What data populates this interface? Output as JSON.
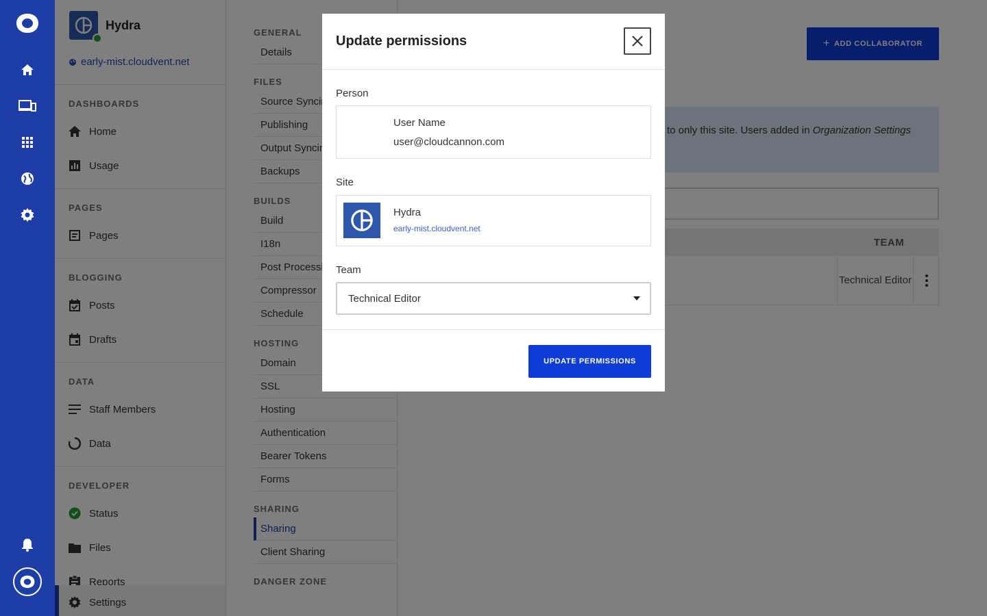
{
  "sidebar": {
    "site_name": "Hydra",
    "site_url": "early-mist.cloudvent.net",
    "sections": [
      {
        "title": "DASHBOARDS",
        "items": [
          {
            "label": "Home",
            "icon": "home-icon"
          },
          {
            "label": "Usage",
            "icon": "chart-icon"
          }
        ]
      },
      {
        "title": "PAGES",
        "items": [
          {
            "label": "Pages",
            "icon": "page-icon"
          }
        ]
      },
      {
        "title": "BLOGGING",
        "items": [
          {
            "label": "Posts",
            "icon": "calendar-check-icon"
          },
          {
            "label": "Drafts",
            "icon": "calendar-icon"
          }
        ]
      },
      {
        "title": "DATA",
        "items": [
          {
            "label": "Staff Members",
            "icon": "list-icon"
          },
          {
            "label": "Data",
            "icon": "data-ring-icon"
          }
        ]
      },
      {
        "title": "DEVELOPER",
        "items": [
          {
            "label": "Status",
            "icon": "check-circle-icon"
          },
          {
            "label": "Files",
            "icon": "folder-icon"
          },
          {
            "label": "Reports",
            "icon": "clipboard-icon"
          }
        ]
      }
    ],
    "settings_label": "Settings"
  },
  "settings_nav": {
    "groups": [
      {
        "title": "GENERAL",
        "items": [
          "Details"
        ]
      },
      {
        "title": "FILES",
        "items": [
          "Source Syncing",
          "Publishing",
          "Output Syncing",
          "Backups"
        ]
      },
      {
        "title": "BUILDS",
        "items": [
          "Build",
          "I18n",
          "Post Processing",
          "Compressor",
          "Schedule"
        ]
      },
      {
        "title": "HOSTING",
        "items": [
          "Domain",
          "SSL",
          "Hosting",
          "Authentication",
          "Bearer Tokens",
          "Forms"
        ]
      },
      {
        "title": "SHARING",
        "items": [
          "Sharing",
          "Client Sharing"
        ]
      }
    ],
    "active": "Sharing",
    "partial_group": "DANGER ZONE"
  },
  "main": {
    "add_button": "ADD COLLABORATOR",
    "info_text": "to only this site. Users added in ",
    "info_italic": "Organization Settings",
    "table_team_header": "TEAM",
    "row_team": "Technical Editor"
  },
  "modal": {
    "title": "Update permissions",
    "person_label": "Person",
    "person_name": "User Name",
    "person_email": "user@cloudcannon.com",
    "site_label": "Site",
    "site_name": "Hydra",
    "site_url": "early-mist.cloudvent.net",
    "team_label": "Team",
    "team_value": "Technical Editor",
    "submit_label": "UPDATE PERMISSIONS"
  },
  "colors": {
    "rail": "#1d3ea6",
    "primary_button": "#0d3cd6",
    "info_bg": "#dbe6f7",
    "status_green": "#2a9d3b"
  }
}
